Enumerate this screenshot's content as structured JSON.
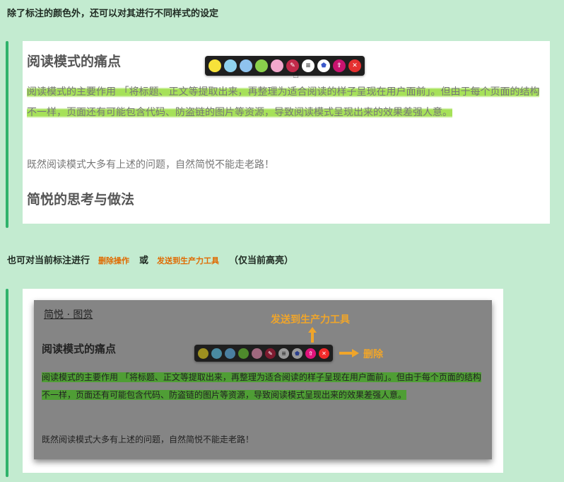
{
  "intro_text": "除了标注的颜色外，还可以对其进行不同样式的设定",
  "demo1": {
    "heading1": "阅读模式的痛点",
    "para1_plain": "阅读模式的主要作用 ",
    "para1_hl": "「将标题、正文等提取出来，再整理为适合阅读的样子呈现在用户面前」。但由于每个页面的结构不一样，页面还有可能包含代码、防盗链的图片等资源，导致阅读模式呈现出来的效果差强人意。",
    "para2": "既然阅读模式大多有上述的问题，自然简悦不能走老路！",
    "heading2": "简悦的思考与做法"
  },
  "toolbar": {
    "colors": [
      "#f7e23a",
      "#8fd2ee",
      "#8fc3ee",
      "#8ad04b",
      "#f2a8cc"
    ],
    "icons": [
      "highlighter-icon",
      "note-icon",
      "tag-icon",
      "export-icon",
      "delete-icon"
    ]
  },
  "mid": {
    "text_before": "也可对当前标注进行",
    "action_delete": "删除操作",
    "text_or": "或",
    "action_send": "发送到生产力工具",
    "text_after": "（仅当前高亮）"
  },
  "demo2": {
    "nav": "简悦  ·  图赏",
    "heading": "阅读模式的痛点",
    "para1_plain": "阅读模式的主要作用 ",
    "para1_hl": "「将标题、正文等提取出来，再整理为适合阅读的样子呈现在用户面前」。但由于每个页面的结构不一样，页面还有可能包含代码、防盗链的图片等资源，导致阅读模式呈现出来的效果差强人意。",
    "para2": "既然阅读模式大多有上述的问题，自然简悦不能走老路！",
    "annotation_send": "发送到生产力工具",
    "annotation_delete": "删除"
  }
}
